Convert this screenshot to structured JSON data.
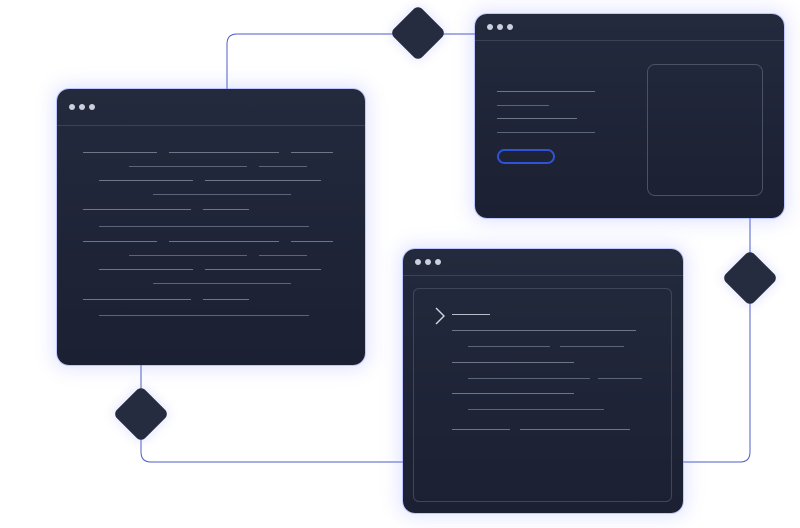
{
  "colors": {
    "background": "#ffffff",
    "window": "#1f2537",
    "connector": "#4d5cc8",
    "button_outline": "#2f52d6",
    "text_line": "#6d7588",
    "dot": "#cbd0dc"
  },
  "icons": [
    "window-dots",
    "terminal-chevron-icon",
    "diamond-node"
  ],
  "windows": {
    "left": {
      "type": "text-document"
    },
    "top_right": {
      "type": "form-with-preview"
    },
    "bottom_right": {
      "type": "terminal"
    }
  }
}
